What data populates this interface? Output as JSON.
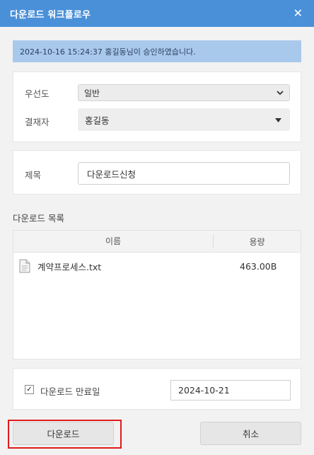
{
  "dialog": {
    "title": "다운로드 워크플로우",
    "close_icon": "close-icon",
    "close_glyph": "✕"
  },
  "notice": {
    "text": "2024-10-16 15:24:37 홍길동님이 승인하였습니다."
  },
  "priority": {
    "label": "우선도",
    "value": "일반"
  },
  "approver": {
    "label": "결재자",
    "value": "홍길동"
  },
  "subject": {
    "label": "제목",
    "value": "다운로드신청"
  },
  "downloads": {
    "section_title": "다운로드 목록",
    "columns": [
      "이름",
      "용량"
    ],
    "files": [
      {
        "name": "계약프로세스.txt",
        "size": "463.00B",
        "icon": "file-icon"
      }
    ]
  },
  "expiry": {
    "checkbox_label": "다운로드 만료일",
    "checked": true,
    "date": "2024-10-21"
  },
  "buttons": {
    "download": "다운로드",
    "cancel": "취소"
  },
  "colors": {
    "titlebar": "#4a90d9",
    "notice_bg": "#a9c9ec",
    "highlight": "#e01b1b"
  }
}
